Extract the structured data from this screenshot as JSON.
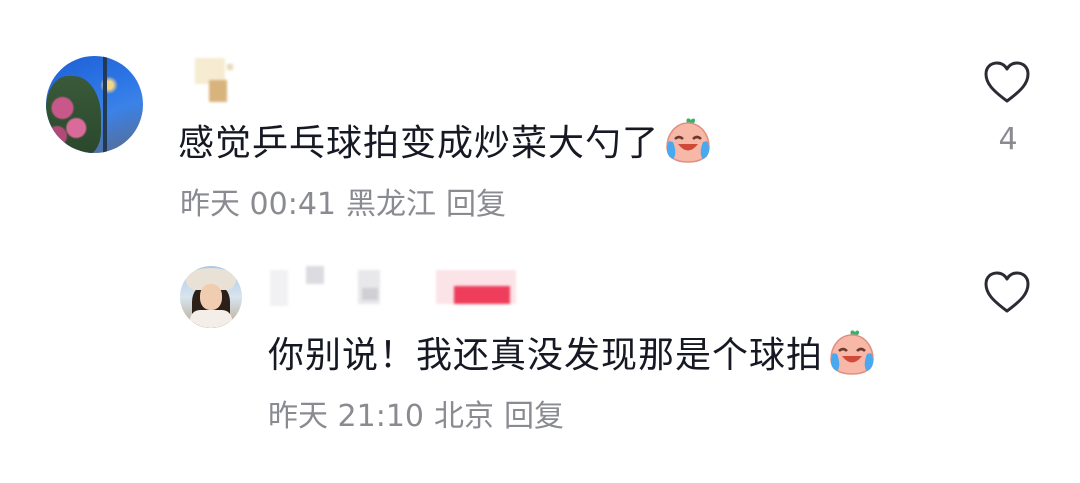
{
  "comment": {
    "text": "感觉乒乓球拍变成炒菜大勺了",
    "emoji": "crying-laughing-face-emoji",
    "time": "昨天 00:41",
    "location": "黑龙江",
    "reply_label": "回复",
    "like_count": "4",
    "icons": {
      "like": "heart-outline-icon"
    },
    "reply": {
      "text": "你别说！我还真没发现那是个球拍",
      "emoji": "crying-laughing-face-emoji",
      "time": "昨天 21:10",
      "location": "北京",
      "reply_label": "回复"
    }
  },
  "colors": {
    "text": "#161823",
    "meta": "#8a8b91",
    "background": "#ffffff"
  }
}
